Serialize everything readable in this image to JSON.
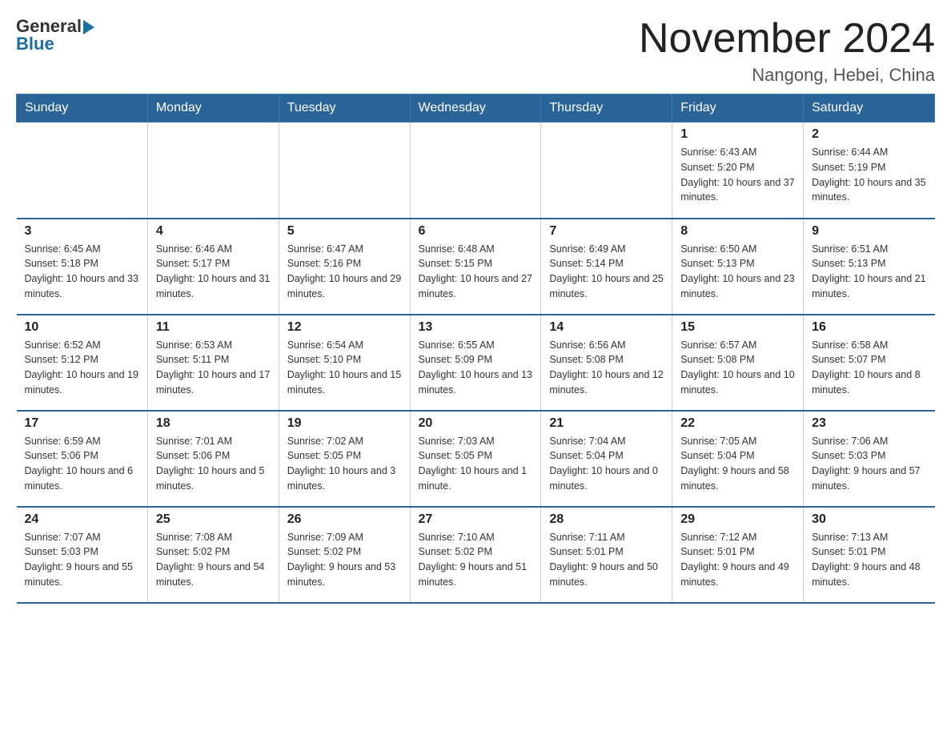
{
  "logo": {
    "general": "General",
    "blue": "Blue"
  },
  "title": "November 2024",
  "location": "Nangong, Hebei, China",
  "days_of_week": [
    "Sunday",
    "Monday",
    "Tuesday",
    "Wednesday",
    "Thursday",
    "Friday",
    "Saturday"
  ],
  "weeks": [
    [
      {
        "day": "",
        "info": ""
      },
      {
        "day": "",
        "info": ""
      },
      {
        "day": "",
        "info": ""
      },
      {
        "day": "",
        "info": ""
      },
      {
        "day": "",
        "info": ""
      },
      {
        "day": "1",
        "info": "Sunrise: 6:43 AM\nSunset: 5:20 PM\nDaylight: 10 hours and 37 minutes."
      },
      {
        "day": "2",
        "info": "Sunrise: 6:44 AM\nSunset: 5:19 PM\nDaylight: 10 hours and 35 minutes."
      }
    ],
    [
      {
        "day": "3",
        "info": "Sunrise: 6:45 AM\nSunset: 5:18 PM\nDaylight: 10 hours and 33 minutes."
      },
      {
        "day": "4",
        "info": "Sunrise: 6:46 AM\nSunset: 5:17 PM\nDaylight: 10 hours and 31 minutes."
      },
      {
        "day": "5",
        "info": "Sunrise: 6:47 AM\nSunset: 5:16 PM\nDaylight: 10 hours and 29 minutes."
      },
      {
        "day": "6",
        "info": "Sunrise: 6:48 AM\nSunset: 5:15 PM\nDaylight: 10 hours and 27 minutes."
      },
      {
        "day": "7",
        "info": "Sunrise: 6:49 AM\nSunset: 5:14 PM\nDaylight: 10 hours and 25 minutes."
      },
      {
        "day": "8",
        "info": "Sunrise: 6:50 AM\nSunset: 5:13 PM\nDaylight: 10 hours and 23 minutes."
      },
      {
        "day": "9",
        "info": "Sunrise: 6:51 AM\nSunset: 5:13 PM\nDaylight: 10 hours and 21 minutes."
      }
    ],
    [
      {
        "day": "10",
        "info": "Sunrise: 6:52 AM\nSunset: 5:12 PM\nDaylight: 10 hours and 19 minutes."
      },
      {
        "day": "11",
        "info": "Sunrise: 6:53 AM\nSunset: 5:11 PM\nDaylight: 10 hours and 17 minutes."
      },
      {
        "day": "12",
        "info": "Sunrise: 6:54 AM\nSunset: 5:10 PM\nDaylight: 10 hours and 15 minutes."
      },
      {
        "day": "13",
        "info": "Sunrise: 6:55 AM\nSunset: 5:09 PM\nDaylight: 10 hours and 13 minutes."
      },
      {
        "day": "14",
        "info": "Sunrise: 6:56 AM\nSunset: 5:08 PM\nDaylight: 10 hours and 12 minutes."
      },
      {
        "day": "15",
        "info": "Sunrise: 6:57 AM\nSunset: 5:08 PM\nDaylight: 10 hours and 10 minutes."
      },
      {
        "day": "16",
        "info": "Sunrise: 6:58 AM\nSunset: 5:07 PM\nDaylight: 10 hours and 8 minutes."
      }
    ],
    [
      {
        "day": "17",
        "info": "Sunrise: 6:59 AM\nSunset: 5:06 PM\nDaylight: 10 hours and 6 minutes."
      },
      {
        "day": "18",
        "info": "Sunrise: 7:01 AM\nSunset: 5:06 PM\nDaylight: 10 hours and 5 minutes."
      },
      {
        "day": "19",
        "info": "Sunrise: 7:02 AM\nSunset: 5:05 PM\nDaylight: 10 hours and 3 minutes."
      },
      {
        "day": "20",
        "info": "Sunrise: 7:03 AM\nSunset: 5:05 PM\nDaylight: 10 hours and 1 minute."
      },
      {
        "day": "21",
        "info": "Sunrise: 7:04 AM\nSunset: 5:04 PM\nDaylight: 10 hours and 0 minutes."
      },
      {
        "day": "22",
        "info": "Sunrise: 7:05 AM\nSunset: 5:04 PM\nDaylight: 9 hours and 58 minutes."
      },
      {
        "day": "23",
        "info": "Sunrise: 7:06 AM\nSunset: 5:03 PM\nDaylight: 9 hours and 57 minutes."
      }
    ],
    [
      {
        "day": "24",
        "info": "Sunrise: 7:07 AM\nSunset: 5:03 PM\nDaylight: 9 hours and 55 minutes."
      },
      {
        "day": "25",
        "info": "Sunrise: 7:08 AM\nSunset: 5:02 PM\nDaylight: 9 hours and 54 minutes."
      },
      {
        "day": "26",
        "info": "Sunrise: 7:09 AM\nSunset: 5:02 PM\nDaylight: 9 hours and 53 minutes."
      },
      {
        "day": "27",
        "info": "Sunrise: 7:10 AM\nSunset: 5:02 PM\nDaylight: 9 hours and 51 minutes."
      },
      {
        "day": "28",
        "info": "Sunrise: 7:11 AM\nSunset: 5:01 PM\nDaylight: 9 hours and 50 minutes."
      },
      {
        "day": "29",
        "info": "Sunrise: 7:12 AM\nSunset: 5:01 PM\nDaylight: 9 hours and 49 minutes."
      },
      {
        "day": "30",
        "info": "Sunrise: 7:13 AM\nSunset: 5:01 PM\nDaylight: 9 hours and 48 minutes."
      }
    ]
  ]
}
